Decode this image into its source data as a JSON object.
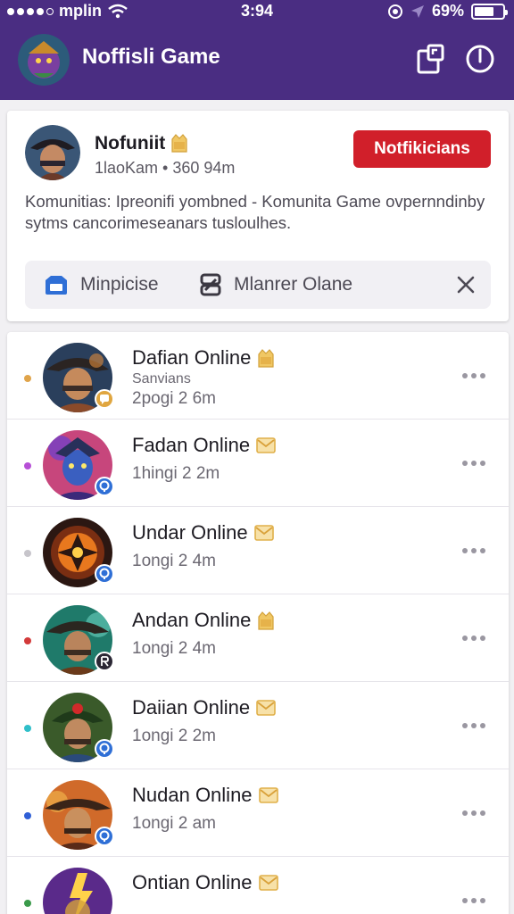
{
  "status_bar": {
    "carrier": "mplin",
    "time": "3:94",
    "battery_percent": "69%",
    "battery_level": 0.69
  },
  "header": {
    "title": "Noffisli Game",
    "colors": {
      "bar": "#4a2d82"
    }
  },
  "profile": {
    "name": "Nofuniit",
    "subtitle": "1laoKam • 360 94m",
    "notifications_button": "Notfikicians",
    "description": "Komunitias: Ipreonifi yombned - Komunita Game ovpernndinby sytms cancorimeseanars tusloulhes.",
    "tabs": [
      {
        "label": "Minpicise",
        "icon": "window-icon"
      },
      {
        "label": "Mlanrer Olane",
        "icon": "link-icon"
      }
    ]
  },
  "list": [
    {
      "name": "Dafian Online",
      "status": "Sanvians",
      "time": "2pogi 2 6m",
      "dot": "#e0a44a",
      "badge_icon": "chat-icon",
      "badge_color": "#e0a640",
      "tag_icon": "trophy-icon",
      "pic": "pirate-warrior"
    },
    {
      "name": "Fadan Online",
      "status": "",
      "time": "1hingi 2 2m",
      "dot": "#b64fd6",
      "badge_icon": "location-icon",
      "badge_color": "#2f6fd6",
      "tag_icon": "mail-icon",
      "pic": "blue-mage"
    },
    {
      "name": "Undar Online",
      "status": "",
      "time": "1ongi 2 4m",
      "dot": "#c7c5cb",
      "badge_icon": "location-icon",
      "badge_color": "#2f6fd6",
      "tag_icon": "mail-icon",
      "pic": "fire-mask"
    },
    {
      "name": "Andan Online",
      "status": "",
      "time": "1ongi 2 4m",
      "dot": "#d33a3a",
      "badge_icon": "r-icon",
      "badge_color": "#2b2734",
      "tag_icon": "trophy-icon",
      "pic": "green-hunter"
    },
    {
      "name": "Daiian Online",
      "status": "",
      "time": "1ongi 2 2m",
      "dot": "#2fbfc9",
      "badge_icon": "location-icon",
      "badge_color": "#2f6fd6",
      "tag_icon": "mail-icon",
      "pic": "forest-ranger"
    },
    {
      "name": "Nudan Online",
      "status": "",
      "time": "1ongi 2 am",
      "dot": "#2f5fd6",
      "badge_icon": "location-icon",
      "badge_color": "#2f6fd6",
      "tag_icon": "mail-icon",
      "pic": "cowboy"
    },
    {
      "name": "Ontian Online",
      "status": "",
      "time": "",
      "dot": "#3a9a4a",
      "badge_icon": "location-icon",
      "badge_color": "#2f6fd6",
      "tag_icon": "mail-icon",
      "pic": "lightning-knight"
    }
  ]
}
